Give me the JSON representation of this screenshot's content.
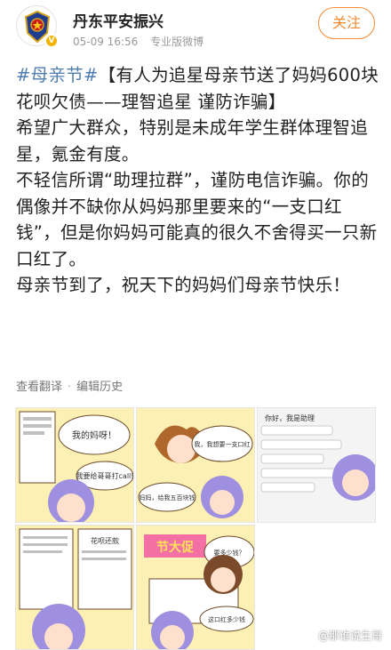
{
  "post": {
    "author": "丹东平安振兴",
    "date": "05-09 16:56",
    "client": "专业版微博",
    "follow_label": "关注",
    "hashtag": "#母亲节#",
    "title": "【有人为追星母亲节送了妈妈600块花呗欠债——理智追星 谨防诈骗】",
    "paragraphs": [
      "希望广大群众，特别是未成年学生群体理智追星，氪金有度。",
      "不轻信所谓“助理拉群”，谨防电信诈骗。你的偶像并不缺你从妈妈那里要来的“一支口红钱”，但是你妈妈可能真的很久不舍得买一只新口红了。",
      "母亲节到了，祝天下的妈妈们母亲节快乐！"
    ],
    "actions": {
      "translate": "查看翻译",
      "separator": "·",
      "history": "编辑历史"
    }
  },
  "images": {
    "comic_texts": {
      "c1_bubble1": "我的妈呀！",
      "c1_bubble2": "我要给哥哥打call!",
      "c2_bubble": "我，我想要一支口红",
      "c2_bubble2": "妈妈，给我五百块钱",
      "c3_bubble": "你好，我是助理",
      "c4_bubble": "花呗还款",
      "c5_banner": "节大促",
      "c5_bubble": "要多少钱？",
      "c6_bubble": "这口红多少钱"
    },
    "watermark": "@那谁说生哥"
  },
  "colors": {
    "link": "#507daf",
    "follow": "#f28a32",
    "meta": "#9a9a9a",
    "badge": "#f2b200",
    "comic_bg": "#fff4c8",
    "comic_border": "#6b4a2b",
    "hair": "#9f8fe0"
  }
}
